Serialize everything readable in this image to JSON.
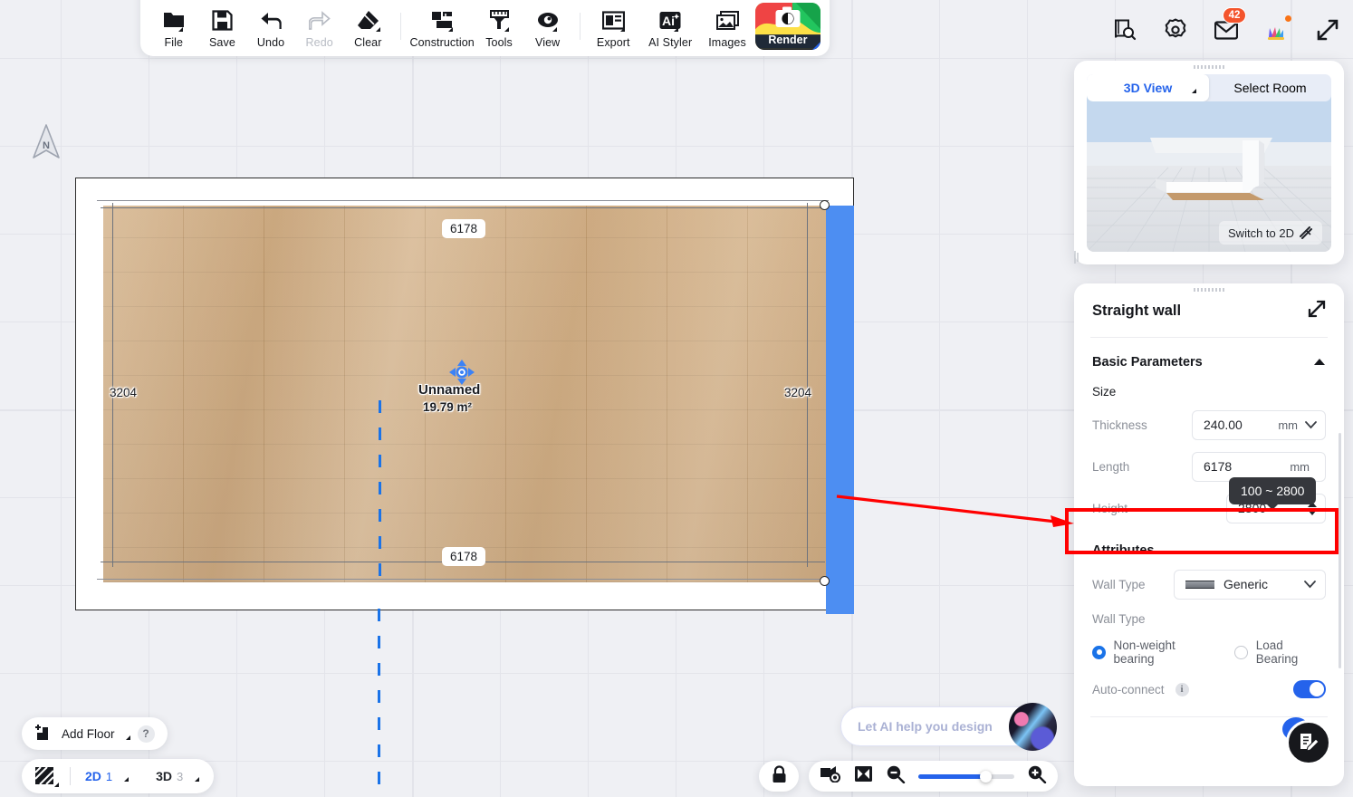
{
  "toolbar": {
    "items": [
      {
        "label": "File",
        "icon": "folder-icon",
        "caret": true,
        "disabled": false
      },
      {
        "label": "Save",
        "icon": "floppy-disk-icon",
        "caret": false,
        "disabled": false
      },
      {
        "label": "Undo",
        "icon": "undo-arrow-icon",
        "caret": false,
        "disabled": false
      },
      {
        "label": "Redo",
        "icon": "redo-arrow-icon",
        "caret": false,
        "disabled": true
      },
      {
        "label": "Clear",
        "icon": "eraser-icon",
        "caret": true,
        "disabled": false
      },
      {
        "label": "Construction",
        "icon": "construction-icon",
        "caret": true,
        "disabled": false
      },
      {
        "label": "Tools",
        "icon": "ruler-tools-icon",
        "caret": true,
        "disabled": false
      },
      {
        "label": "View",
        "icon": "eye-icon",
        "caret": true,
        "disabled": false
      },
      {
        "label": "Export",
        "icon": "export-panel-icon",
        "caret": true,
        "disabled": false
      },
      {
        "label": "AI Styler",
        "icon": "ai-styler-icon",
        "caret": true,
        "disabled": false
      },
      {
        "label": "Images",
        "icon": "images-icon",
        "caret": false,
        "disabled": false
      }
    ],
    "render_label": "Render"
  },
  "topright": {
    "icons": [
      {
        "name": "book-search-icon"
      },
      {
        "name": "gear-icon"
      },
      {
        "name": "mail-icon",
        "badge": "42"
      },
      {
        "name": "color-fan-icon",
        "dot": true
      },
      {
        "name": "expand-diagonal-icon"
      }
    ]
  },
  "canvas": {
    "compass_label": "N",
    "room_name": "Unnamed",
    "room_area": "19.79 m²",
    "dim_top": "6178",
    "dim_bottom": "6178",
    "dim_left": "3204",
    "dim_right": "3204",
    "selected_wall_color": "#4d8ef2"
  },
  "view_panel": {
    "tab_3d": "3D View",
    "tab_select_room": "Select Room",
    "switch_label": "Switch to 2D"
  },
  "properties": {
    "title": "Straight wall",
    "section_basic": "Basic Parameters",
    "size_label": "Size",
    "thickness_label": "Thickness",
    "thickness_value": "240.00",
    "thickness_unit": "mm",
    "length_label": "Length",
    "length_value": "6178",
    "length_unit": "mm",
    "height_label": "Height",
    "height_value": "2800",
    "tooltip": "100 ~ 2800",
    "attributes_label": "Attributes",
    "wall_type_label": "Wall Type",
    "wall_type_value": "Generic",
    "wall_type_label2": "Wall Type",
    "radio_nonweight": "Non-weight bearing",
    "radio_loadbearing": "Load Bearing",
    "autoconnect_label": "Auto-connect",
    "autoconnect_on": true,
    "highlight_color": "#ff0000"
  },
  "bottom_left": {
    "add_floor": "Add Floor",
    "help": "?",
    "view_2d": "2D",
    "view_2d_count": "1",
    "view_3d": "3D",
    "view_3d_count": "3"
  },
  "bottom_center": {
    "lock_icon": "lock-icon",
    "camera_icon": "camera-view-icon",
    "fit_icon": "fit-screen-icon",
    "zoom_out_icon": "zoom-out-icon",
    "zoom_in_icon": "zoom-in-icon"
  },
  "ai_bar": {
    "placeholder": "Let AI help you design"
  }
}
